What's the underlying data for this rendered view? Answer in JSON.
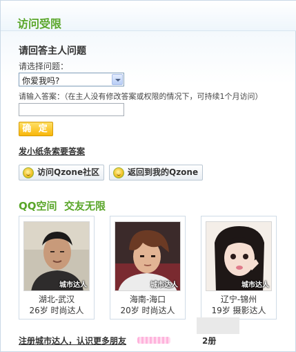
{
  "header": {
    "title": "访问受限"
  },
  "question": {
    "heading": "请回答主人问题",
    "select_label": "请选择问题：",
    "selected": "你爱我吗?",
    "answer_label": "请输入答案：（在主人没有修改答案或权限的情况下，可持续1个月访问）",
    "confirm_label": "确 定"
  },
  "links": {
    "send_note": "发小纸条索要答案",
    "visit_community": "访问Qzone社区",
    "back_my_qzone": "返回到我的Qzone"
  },
  "section": {
    "title": "QQ空间  交友无限"
  },
  "cards": [
    {
      "tag": "城市达人",
      "location": "湖北-武汉",
      "meta": "26岁 时尚达人"
    },
    {
      "tag": "城市达人",
      "location": "海南-海口",
      "meta": "20岁 时尚达人"
    },
    {
      "tag": "城市达人",
      "location": "辽宁-锦州",
      "meta": "19岁 摄影达人"
    }
  ],
  "footer": {
    "register": "注册城市达人，认识更多朋友",
    "tail": "2册"
  },
  "colors": {
    "accent_green": "#5aa62a",
    "button_orange": "#f8b60a"
  },
  "icons": [
    "qzone-smiley-icon",
    "dropdown-arrow-icon"
  ]
}
